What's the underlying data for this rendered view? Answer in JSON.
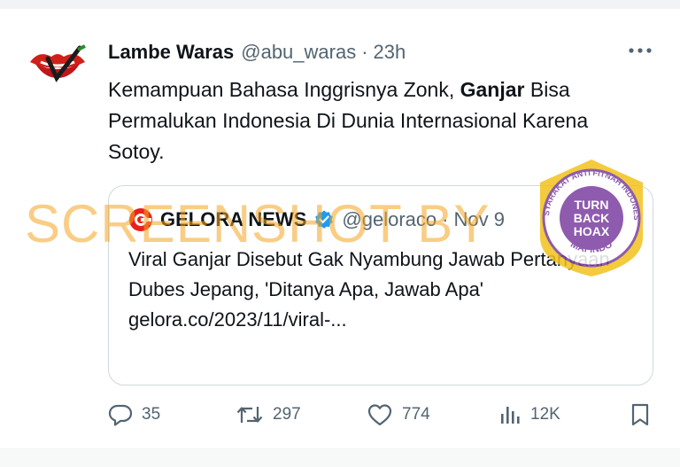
{
  "colors": {
    "accent": "#1d9bf0",
    "muted": "#536471",
    "text": "#0f1419",
    "watermark": "#f5a623",
    "stamp": "#7b3fa0"
  },
  "tweet": {
    "author_name": "Lambe Waras",
    "author_handle": "@abu_waras",
    "separator": "·",
    "time": "23h",
    "more_icon": "more-horizontal-icon",
    "text_before": "Kemampuan Bahasa Inggrisnya Zonk, ",
    "text_bold": "Ganjar",
    "text_after": " Bisa Permalukan Indonesia Di Dunia Internasional Karena Sotoy."
  },
  "quote": {
    "author_name": "GELORA NEWS",
    "author_handle": "@geloraco",
    "separator": "·",
    "time": "Nov 9",
    "text": "Viral Ganjar Disebut Gak Nyambung Jawab Pertanyaan Dubes Jepang, 'Ditanya Apa, Jawab Apa'",
    "link": "gelora.co/2023/11/viral-..."
  },
  "actions": {
    "replies": "35",
    "reposts": "297",
    "likes": "774",
    "views": "12K"
  },
  "overlay": {
    "watermark": "SCREENSHOT BY",
    "stamp_top": "MASYARAKAT ANTI FITNAH INDONESIA",
    "stamp_line1": "TURN",
    "stamp_line2": "BACK",
    "stamp_line3": "HOAX",
    "stamp_bottom": "MAFINDO"
  }
}
